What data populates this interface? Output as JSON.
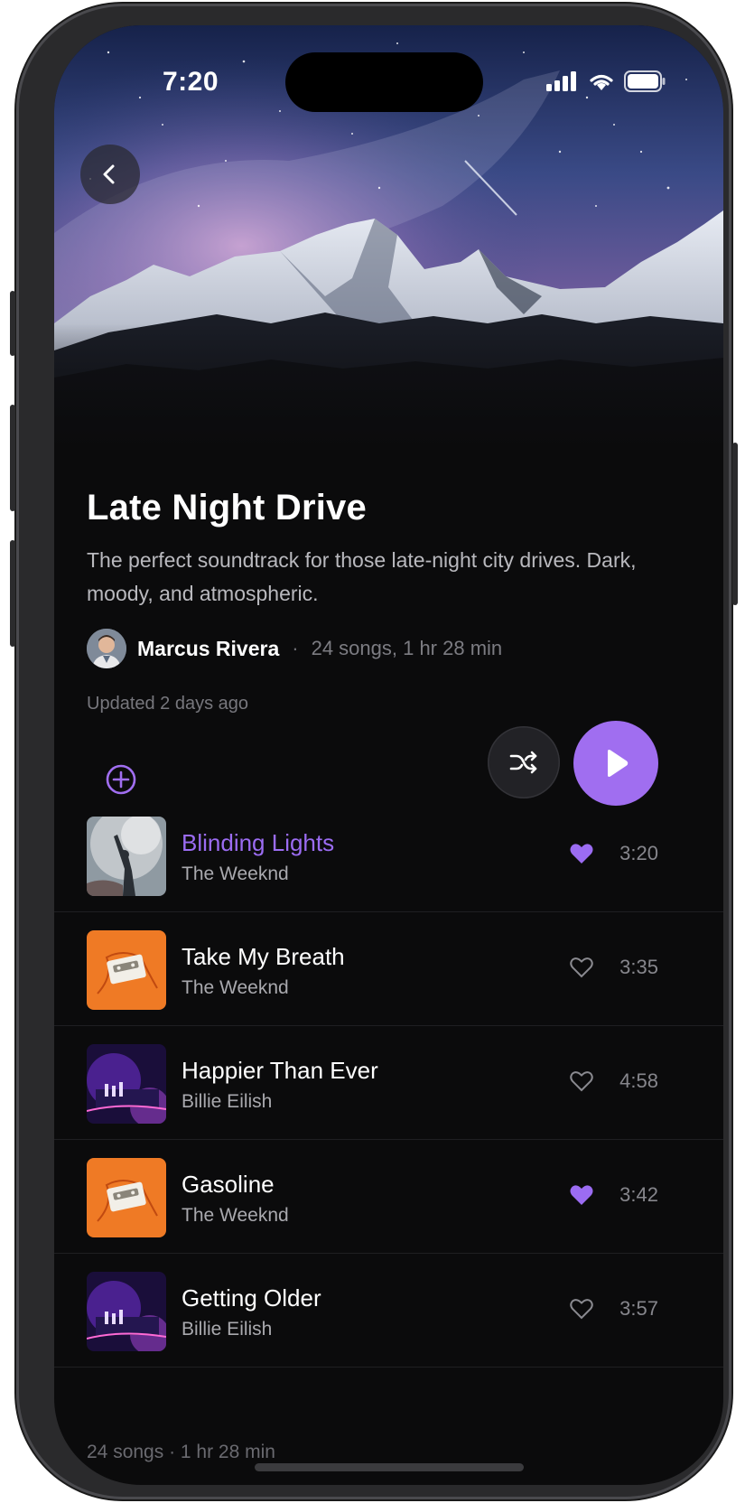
{
  "status_bar": {
    "time": "7:20"
  },
  "playlist": {
    "title": "Late Night Drive",
    "description": "The perfect soundtrack for those late-night city drives. Dark, moody, and atmospheric.",
    "owner": "Marcus Rivera",
    "separator": "·",
    "counts": "24 songs, 1 hr 28 min",
    "updated": "Updated 2 days ago"
  },
  "tracks": [
    {
      "title": "Blinding Lights",
      "artist": "The Weeknd",
      "duration": "3:20",
      "liked": true,
      "playing": true,
      "cover": "concert-photo"
    },
    {
      "title": "Take My Breath",
      "artist": "The Weeknd",
      "duration": "3:35",
      "liked": false,
      "playing": false,
      "cover": "orange-cassette"
    },
    {
      "title": "Happier Than Ever",
      "artist": "Billie Eilish",
      "duration": "4:58",
      "liked": false,
      "playing": false,
      "cover": "purple-dj"
    },
    {
      "title": "Gasoline",
      "artist": "The Weeknd",
      "duration": "3:42",
      "liked": true,
      "playing": false,
      "cover": "orange-cassette"
    },
    {
      "title": "Getting Older",
      "artist": "Billie Eilish",
      "duration": "3:57",
      "liked": false,
      "playing": false,
      "cover": "purple-dj"
    }
  ],
  "footer": {
    "summary": "24 songs · 1 hr 28 min"
  },
  "icons": {
    "back": "chevron-left-icon",
    "add": "plus-circle-icon",
    "shuffle": "shuffle-icon",
    "play": "play-icon",
    "heart": "heart-icon"
  },
  "colors": {
    "accent": "#a06ef0",
    "active_track": "#9b6cf2",
    "background": "#0b0b0c"
  }
}
